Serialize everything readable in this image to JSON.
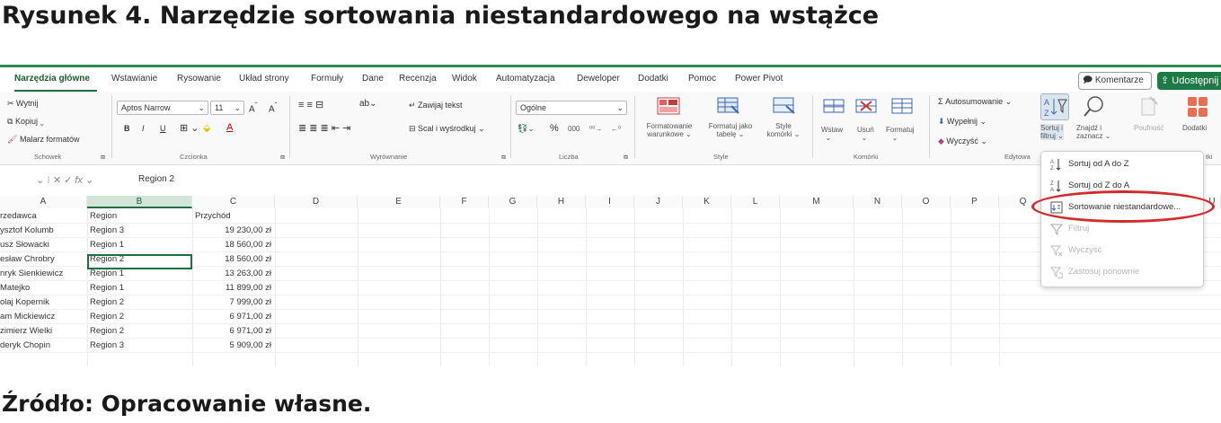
{
  "figure": {
    "title": "Rysunek 4. Narzędzie sortowania niestandardowego na wstążce",
    "source": "Źródło: Opracowanie własne."
  },
  "ribbon_tabs": [
    {
      "label": "Narzędzia główne",
      "active": true
    },
    {
      "label": "Wstawianie"
    },
    {
      "label": "Rysowanie"
    },
    {
      "label": "Układ strony"
    },
    {
      "label": "Formuły"
    },
    {
      "label": "Dane"
    },
    {
      "label": "Recenzja"
    },
    {
      "label": "Widok"
    },
    {
      "label": "Automatyzacja"
    },
    {
      "label": "Deweloper"
    },
    {
      "label": "Dodatki"
    },
    {
      "label": "Pomoc"
    },
    {
      "label": "Power Pivot"
    }
  ],
  "top_right": {
    "comments": "Komentarze",
    "share": "Udostępnij"
  },
  "clipboard": {
    "cut": "Wytnij",
    "copy": "Kopiuj",
    "format_painter": "Malarz formatów",
    "group": "Schowek"
  },
  "font": {
    "name": "Aptos Narrow",
    "size": "11",
    "bold": "B",
    "italic": "I",
    "underline": "U",
    "group": "Czcionka"
  },
  "alignment": {
    "wrap": "Zawijaj tekst",
    "merge": "Scal i wyśrodkuj",
    "group": "Wyrównanie"
  },
  "number": {
    "format": "Ogólne",
    "percent": "%",
    "thousands": "000",
    "group": "Liczba"
  },
  "styles": {
    "conditional": [
      "Formatowanie",
      "warunkowe"
    ],
    "table": [
      "Formatuj jako",
      "tabelę"
    ],
    "cell": [
      "Style",
      "komórki"
    ],
    "group": "Style"
  },
  "cells": {
    "insert": "Wstaw",
    "delete": "Usuń",
    "format": "Formatuj",
    "group": "Komórki"
  },
  "editing": {
    "autosum": "Autosumowanie",
    "fill": "Wypełnij",
    "clear": "Wyczyść",
    "group": "Edytowa",
    "sort_filter": [
      "Sortuj i",
      "filtruj"
    ],
    "find_select": [
      "Znajdź i",
      "zaznacz"
    ],
    "sensitivity": "Poufność",
    "addins": "Dodatki",
    "addins_group": "tki"
  },
  "formula_bar": {
    "fx": "fx",
    "value": "Region 2"
  },
  "columns": [
    "A",
    "B",
    "C",
    "D",
    "E",
    "F",
    "G",
    "H",
    "I",
    "J",
    "K",
    "L",
    "M",
    "N",
    "O",
    "P",
    "Q"
  ],
  "column_extra": "U",
  "table": {
    "headers": [
      "rzedawca",
      "Region",
      "Przychód"
    ],
    "rows": [
      [
        "ysztof Kolumb",
        "Region 3",
        "19 230,00 zł"
      ],
      [
        "usz Słowacki",
        "Region 1",
        "18 560,00 zł"
      ],
      [
        "esław Chrobry",
        "Region 2",
        "18 560,00 zł"
      ],
      [
        "nryk Sienkiewicz",
        "Region 1",
        "13 263,00 zł"
      ],
      [
        "Matejko",
        "Region 1",
        "11 899,00 zł"
      ],
      [
        "olaj Kopernik",
        "Region 2",
        "7 999,00 zł"
      ],
      [
        "am Mickiewicz",
        "Region 2",
        "6 971,00 zł"
      ],
      [
        "zimierz Wielki",
        "Region 2",
        "6 971,00 zł"
      ],
      [
        "deryk Chopin",
        "Region 3",
        "5 909,00 zł"
      ]
    ]
  },
  "sort_menu": {
    "items": [
      {
        "label": "Sortuj od A do Z",
        "enabled": true
      },
      {
        "label": "Sortuj od Z do A",
        "enabled": true
      },
      {
        "label": "Sortowanie niestandardowe...",
        "enabled": true,
        "highlighted": true
      },
      {
        "label": "Filtruj",
        "enabled": false
      },
      {
        "label": "Wyczyść",
        "enabled": false
      },
      {
        "label": "Zastosuj ponownie",
        "enabled": false
      }
    ]
  },
  "colors": {
    "accent": "#1d6f42",
    "highlight_ring": "#d22b2b"
  }
}
